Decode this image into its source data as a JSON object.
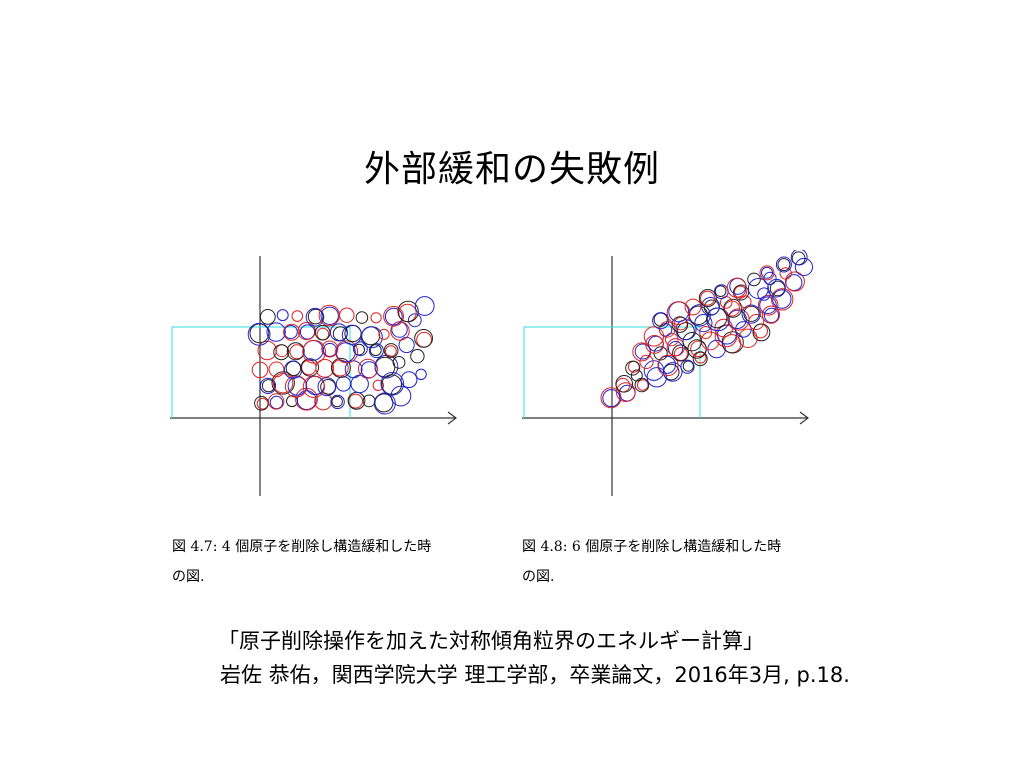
{
  "title": "外部緩和の失敗例",
  "figures": [
    {
      "caption_line1": "図 4.7:  4 個原子を削除し構造緩和した時",
      "caption_line2": "の図.",
      "colors": {
        "axis": "#333333",
        "box": "#33dddd",
        "atomA": "#2222cc",
        "atomB": "#dd2222",
        "atomC": "#222222"
      }
    },
    {
      "caption_line1": "図 4.8:  6 個原子を削除し構造緩和した時",
      "caption_line2": "の図.",
      "colors": {
        "axis": "#333333",
        "box": "#33dddd",
        "atomA": "#2222cc",
        "atomB": "#dd2222",
        "atomC": "#222222"
      }
    }
  ],
  "citation": {
    "line1": "「原子削除操作を加えた対称傾角粒界のエネルギー計算」",
    "line2": "岩佐 恭佑，関西学院大学 理工学部，卒業論文，2016年3月, p.18."
  }
}
